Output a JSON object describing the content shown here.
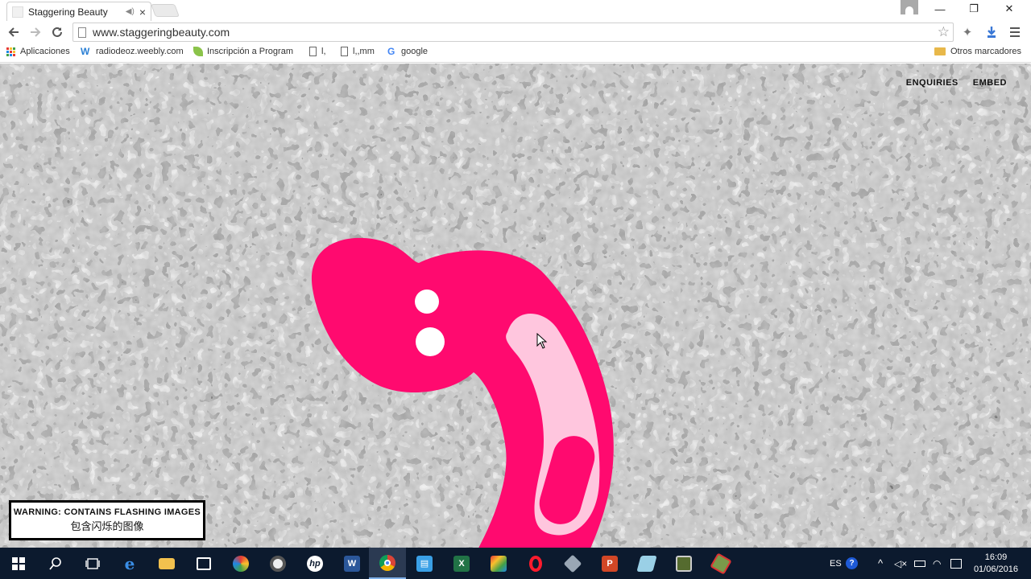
{
  "browser": {
    "tab_title": "Staggering Beauty",
    "tab_audio_icon": "speaker-icon",
    "tab_close": "×",
    "url": "www.staggeringbeauty.com",
    "window_controls": {
      "minimize": "—",
      "maximize": "❐",
      "close": "✕"
    }
  },
  "bookmarks": [
    {
      "label": "Aplicaciones",
      "icon": "apps-grid-icon"
    },
    {
      "label": "radiodeoz.weebly.com",
      "icon": "weebly-icon"
    },
    {
      "label": "Inscripción a Program",
      "icon": "leaf-icon"
    },
    {
      "label": "l,",
      "icon": "document-icon"
    },
    {
      "label": "l,,mm",
      "icon": "document-icon"
    },
    {
      "label": "google",
      "icon": "google-icon"
    }
  ],
  "other_bookmarks": "Otros marcadores",
  "page": {
    "nav_enquiries": "ENQUIRIES",
    "nav_embed": "EMBED",
    "warning_en": "WARNING: CONTAINS FLASHING IMAGES",
    "warning_zh": "包含闪烁的图像",
    "colors": {
      "worm": "#ff0a6f",
      "worm_light": "#ffc6de",
      "warning_border": "#000000"
    }
  },
  "taskbar": {
    "language": "ES",
    "time": "16:09",
    "date": "01/06/2016",
    "apps": [
      "start",
      "search",
      "task-view",
      "edge",
      "file-explorer",
      "store",
      "cliente",
      "media",
      "hp",
      "word",
      "chrome",
      "outlook",
      "excel",
      "photos",
      "opera",
      "3d",
      "powerpoint",
      "notes",
      "terminal",
      "game"
    ]
  }
}
